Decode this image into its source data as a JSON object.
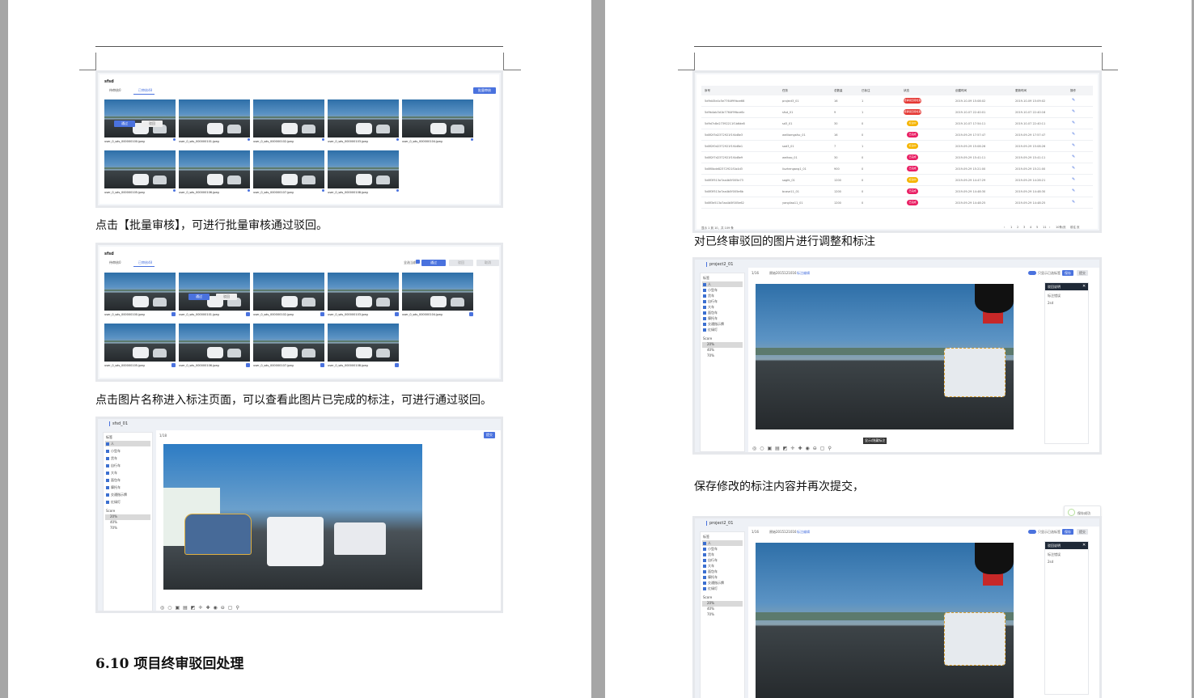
{
  "paragraphs": {
    "batch_review": "点击【批量审核】，可进行批量审核通过驳回。",
    "click_image_name": "点击图片名称进入标注页面，可以查看此图片已完成的标注，可进行通过驳回。",
    "adjust_rejected": "对已终审驳回的图片进行调整和标注",
    "save_resubmit": "保存修改的标注内容并再次提交，"
  },
  "section_heading": "6.10 项目终审驳回处理",
  "shot1": {
    "project": "sfsd",
    "tab_a": "待审核0",
    "tab_b": "已审核48",
    "batch_button": "批量审核",
    "pass": "通过",
    "reject": "驳回",
    "files_row1": [
      "user_0_sds_000000100.jpeg",
      "user_0_sds_000000101.jpeg",
      "user_0_sds_000000102.jpeg",
      "user_0_sds_000000103.jpeg",
      "user_0_sds_000000104.jpeg"
    ],
    "files_row2": [
      "user_0_sds_000000105.jpeg",
      "user_0_sds_000000106.jpeg",
      "user_0_sds_000000107.jpeg",
      "user_0_sds_000000108.jpeg"
    ]
  },
  "shot2": {
    "project": "sfsd",
    "tab_a": "待审核0",
    "tab_b": "已审核48",
    "select_all": "全选当前",
    "pass": "通过",
    "reject": "驳回",
    "cancel": "取消",
    "files_row1": [
      "user_0_sds_000000100.jpeg",
      "user_0_sds_000000101.jpeg",
      "user_0_sds_000000102.jpeg",
      "user_0_sds_000000103.jpeg",
      "user_0_sds_000000104.jpeg"
    ],
    "files_row2": [
      "user_0_sds_000000105.jpeg",
      "user_0_sds_000000106.jpeg",
      "user_0_sds_000000107.jpeg",
      "user_0_sds_000000108.jpeg"
    ]
  },
  "shot3": {
    "project": "sfsd_01",
    "nav": "1/18",
    "submit": "提交",
    "labels": [
      "人",
      "小型车",
      "货车",
      "自行车",
      "大车",
      "面包车",
      "摩托车",
      "交通指示牌",
      "红绿灯"
    ],
    "score_label": "Score",
    "scores": [
      "20%",
      "40%",
      "70%"
    ]
  },
  "table": {
    "headers": [
      "序号",
      "任务",
      "总数量",
      "已标注",
      "状态",
      "创建时间",
      "更新时间",
      "操作"
    ],
    "rows": [
      {
        "id": "5d9d45e4c5e7764f99bce66",
        "task": "project3_01",
        "total": "16",
        "done": "1",
        "status": "终审驳回待处理",
        "status_color": "#e53935",
        "created": "2019-10-09 15:08:02",
        "updated": "2019-10-09 15:09:02"
      },
      {
        "id": "5d9b4ab3d1b7764f99bce6c",
        "task": "sfsd_01",
        "total": "9",
        "done": "1",
        "status": "终审驳回待处理",
        "status_color": "#e53935",
        "created": "2019-10-07 22:40:01",
        "updated": "2019-10-07 22:40:16"
      },
      {
        "id": "5d9d7c8e27392211f1b6de8",
        "task": "sd3_01",
        "total": "30",
        "done": "0",
        "status": "标注中",
        "status_color": "#f5b400",
        "created": "2019-10-07 17:54:11",
        "updated": "2019-10-07 22:40:11"
      },
      {
        "id": "5d8f2f3d2372921f1f4d8e3",
        "task": "welliamgsfsc_01",
        "total": "16",
        "done": "0",
        "status": "已完成",
        "status_color": "#e91e63",
        "created": "2019-09-29 17:57:47",
        "updated": "2019-09-29 17:57:47"
      },
      {
        "id": "5d8f2f0d2372921f1f4d8e1",
        "task": "sad3_01",
        "total": "7",
        "done": "1",
        "status": "标注中",
        "status_color": "#f5b400",
        "created": "2019-09-29 15:08:26",
        "updated": "2019-09-29 15:08:26"
      },
      {
        "id": "5d8f2f7d2372921f1f4d8e9",
        "task": "weihao_01",
        "total": "30",
        "done": "0",
        "status": "已完成",
        "status_color": "#e91e63",
        "created": "2019-09-29 15:41:11",
        "updated": "2019-09-29 15:41:11"
      },
      {
        "id": "5d8f0bde82372921f1b4d3",
        "task": "liuzhengang1_01",
        "total": "900",
        "done": "0",
        "status": "已完成",
        "status_color": "#e91e63",
        "created": "2019-09-29 15:21:00",
        "updated": "2019-09-29 15:21:00"
      },
      {
        "id": "5d8f3f513a7aa4b5f005e73",
        "task": "sagfe_01",
        "total": "1200",
        "done": "0",
        "status": "标注中",
        "status_color": "#f5b400",
        "created": "2019-09-29 14:47:29",
        "updated": "2019-09-29 14:26:21"
      },
      {
        "id": "5d8f3f513a7aa4b5f005e6b",
        "task": "bcase11_01",
        "total": "1200",
        "done": "0",
        "status": "已完成",
        "status_color": "#e91e63",
        "created": "2019-09-29 14:48:30",
        "updated": "2019-09-29 14:48:30"
      },
      {
        "id": "5d8f3e513a7aa4b5f005e62",
        "task": "yangliao11_01",
        "total": "1200",
        "done": "0",
        "status": "已完成",
        "status_color": "#e91e63",
        "created": "2019-09-29 14:48:25",
        "updated": "2019-09-29 14:48:25"
      }
    ],
    "footer_total": "显示 1 到 10，共 109 条",
    "pager": [
      "‹",
      "1",
      "2",
      "3",
      "4",
      "5",
      "11",
      "›",
      "10条/页",
      "前往",
      "页"
    ]
  },
  "shot4": {
    "project": "project2_01",
    "nav": "1/16",
    "file": "原始2015121016",
    "flag": "标注编辑",
    "toggle_label": "只显示已选标签",
    "save": "保存",
    "submit": "提交",
    "panel_title": "驳回说明",
    "panel_sub": "标注错误",
    "panel_text": "2sd",
    "labels": [
      "人",
      "小型车",
      "货车",
      "自行车",
      "大车",
      "面包车",
      "摩托车",
      "交通指示牌",
      "红绿灯"
    ],
    "score_label": "Score",
    "scores": [
      "20%",
      "40%",
      "70%"
    ],
    "tooltip": "显示/隐藏标注"
  },
  "shot5": {
    "project": "project2_01",
    "nav": "1/16",
    "file": "原始2015121016",
    "flag": "标注编辑",
    "toggle_label": "只显示已选标签",
    "save": "保存",
    "submit": "提交",
    "panel_title": "驳回说明",
    "panel_sub": "标注错误",
    "panel_text": "2sd",
    "toast": "保存成功",
    "labels": [
      "人",
      "小型车",
      "货车",
      "自行车",
      "大车",
      "面包车",
      "摩托车",
      "交通指示牌",
      "红绿灯"
    ],
    "score_label": "Score",
    "scores": [
      "20%",
      "40%",
      "70%"
    ]
  },
  "colors": {
    "accent": "#4a72de",
    "red": "#e53935",
    "yellow": "#f5b400",
    "pink": "#e91e63",
    "annotation": "#e0b040"
  }
}
